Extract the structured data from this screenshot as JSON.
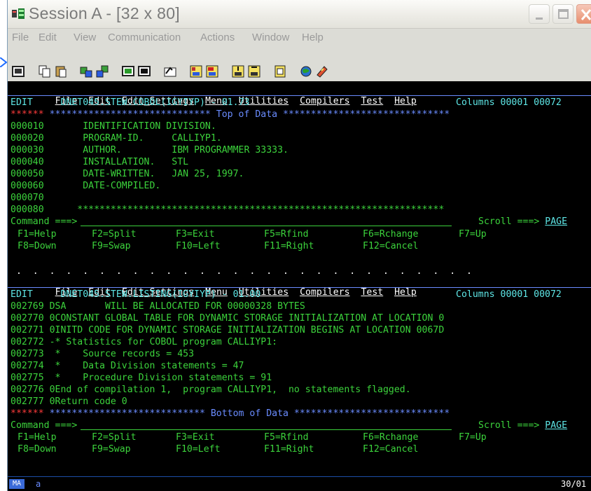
{
  "window": {
    "title": "Session A - [32 x 80]",
    "menu": [
      "File",
      "Edit",
      "View",
      "Communication",
      "Actions",
      "Window",
      "Help"
    ]
  },
  "toolbar": {
    "icons": [
      "print-screen-icon",
      "copy-icon",
      "paste-icon",
      "send-file-icon",
      "receive-file-icon",
      "display-icon",
      "keypad-icon",
      "macro-record-icon",
      "macro-play-icon",
      "macro-stop-icon",
      "transfer-up-icon",
      "transfer-down-icon",
      "clipboard-icon",
      "color-map-icon",
      "help-icon"
    ]
  },
  "pane1": {
    "ispf_menu": [
      "File",
      "Edit",
      "Edit_Settings",
      "Menu",
      "Utilities",
      "Compilers",
      "Test",
      "Help"
    ],
    "mode": "EDIT",
    "dataset": "DNET045.STEW.COBOL(IGYIYP) - 01.73",
    "columns": "Columns 00001 00072",
    "top_marker": "****** ***************************** Top of Data ******************************",
    "lines": [
      {
        "num": "000010",
        "text": "       IDENTIFICATION DIVISION."
      },
      {
        "num": "000020",
        "text": "       PROGRAM-ID.     CALLIYP1."
      },
      {
        "num": "000030",
        "text": "       AUTHOR.         IBM PROGRAMMER 33333."
      },
      {
        "num": "000040",
        "text": "       INSTALLATION.   STL"
      },
      {
        "num": "000050",
        "text": "       DATE-WRITTEN.   JAN 25, 1997."
      },
      {
        "num": "000060",
        "text": "       DATE-COMPILED."
      },
      {
        "num": "000070",
        "text": ""
      },
      {
        "num": "000080",
        "text": "      ******************************************************************"
      }
    ],
    "command_label": "Command ===>",
    "scroll_label": "Scroll ===>",
    "scroll_value": "PAGE",
    "fkeys_row1": [
      "F1=Help",
      "F2=Split",
      "F3=Exit",
      "F5=Rfind",
      "F6=Rchange",
      "F7=Up"
    ],
    "fkeys_row2": [
      "F8=Down",
      "F9=Swap",
      "F10=Left",
      "F11=Right",
      "F12=Cancel"
    ]
  },
  "split_line": " .  .  .  .  .  .  .  .  .  .  .  .  .  .  .  .  .  .  .  .  .  .  .  .  .  .  .  .",
  "pane2": {
    "ispf_menu": [
      "File",
      "Edit",
      "Edit_Settings",
      "Menu",
      "Utilities",
      "Compilers",
      "Test",
      "Help"
    ],
    "mode": "EDIT",
    "dataset": "DNET045.STEW.LISTING(IGYIYP) - 01.00",
    "columns": "Columns 00001 00072",
    "lines": [
      {
        "num": "002769",
        "text": " DSA       WILL BE ALLOCATED FOR 00000328 BYTES"
      },
      {
        "num": "002770",
        "text": " 0CONSTANT GLOBAL TABLE FOR DYNAMIC STORAGE INITIALIZATION AT LOCATION 0"
      },
      {
        "num": "002771",
        "text": " 0INITD CODE FOR DYNAMIC STORAGE INITIALIZATION BEGINS AT LOCATION 0067D"
      },
      {
        "num": "002772",
        "text": " -* Statistics for COBOL program CALLIYP1:"
      },
      {
        "num": "002773",
        "text": "  *    Source records = 453"
      },
      {
        "num": "002774",
        "text": "  *    Data Division statements = 47"
      },
      {
        "num": "002775",
        "text": "  *    Procedure Division statements = 91"
      },
      {
        "num": "002776",
        "text": " 0End of compilation 1,  program CALLIYP1,  no statements flagged."
      },
      {
        "num": "002777",
        "text": " 0Return code 0"
      }
    ],
    "bottom_marker": "****** **************************** Bottom of Data ****************************",
    "command_label": "Command ===>",
    "scroll_label": "Scroll ===>",
    "scroll_value": "PAGE",
    "fkeys_row1": [
      "F1=Help",
      "F2=Split",
      "F3=Exit",
      "F5=Rfind",
      "F6=Rchange",
      "F7=Up"
    ],
    "fkeys_row2": [
      "F8=Down",
      "F9=Swap",
      "F10=Left",
      "F11=Right",
      "F12=Cancel"
    ]
  },
  "status": {
    "indicator": "MA",
    "session": "a",
    "cursor": "30/01"
  },
  "colors": {
    "terminal_bg": "#000000",
    "text_green": "#3cd33c",
    "text_red": "#ff3b3b",
    "text_blue": "#6a8cff",
    "text_white": "#ffffff",
    "text_cyan": "#5ee6e6",
    "text_yellow": "#f0f040"
  }
}
